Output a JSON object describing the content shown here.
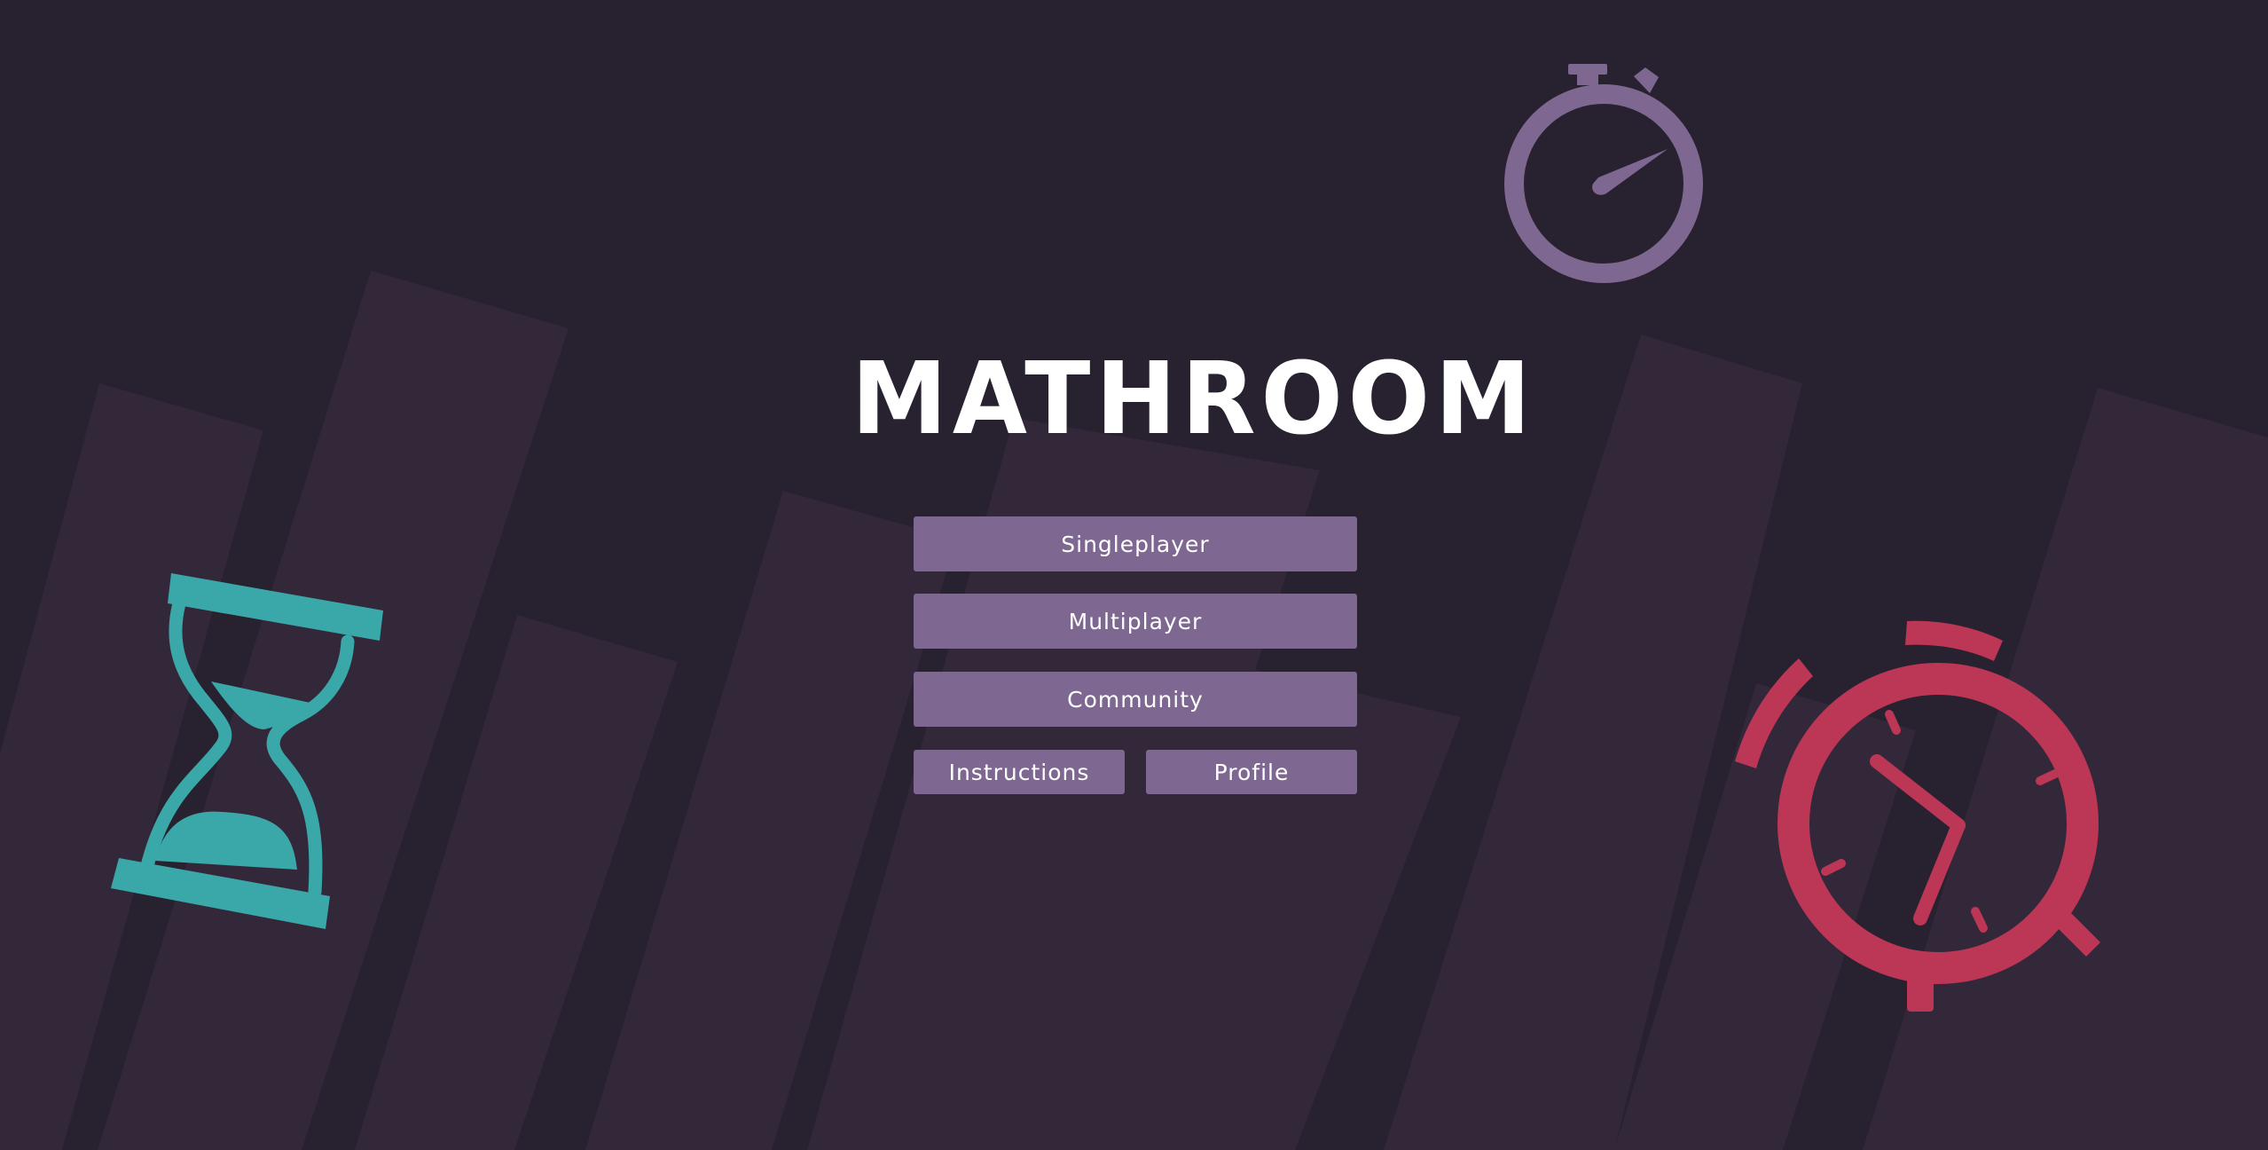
{
  "app": {
    "title": "MATHROOM"
  },
  "menu": {
    "singleplayer_label": "Singleplayer",
    "multiplayer_label": "Multiplayer",
    "community_label": "Community",
    "instructions_label": "Instructions",
    "profile_label": "Profile"
  },
  "decorations": {
    "left_icon": "hourglass-icon",
    "top_icon": "stopwatch-icon",
    "right_icon": "alarm-clock-icon"
  },
  "colors": {
    "background": "#282130",
    "background_stripe": "#33273a",
    "button": "#7e6791",
    "hourglass": "#3aa7a9",
    "stopwatch": "#7e6791",
    "alarm_clock": "#bc3656",
    "text": "#ffffff"
  }
}
